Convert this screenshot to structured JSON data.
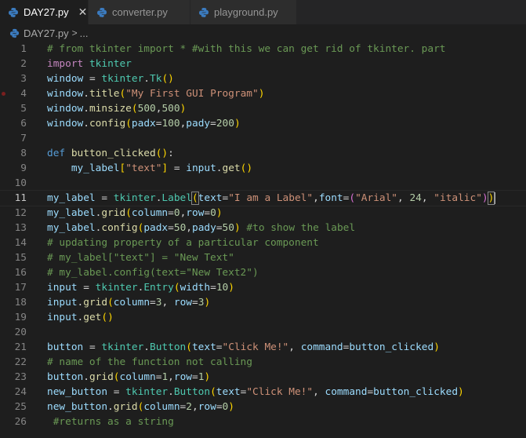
{
  "tabs": [
    {
      "label": "DAY27.py",
      "close": "✕"
    },
    {
      "label": "converter.py",
      "close": "✕"
    },
    {
      "label": "playground.py",
      "close": "✕"
    }
  ],
  "breadcrumb": {
    "file": "DAY27.py",
    "separator": ">",
    "more": "..."
  },
  "colors": {
    "background": "#1e1e1e",
    "comment": "#6a9955",
    "keyword": "#c586c0",
    "variable": "#9cdcfe",
    "function": "#dcdcaa",
    "class": "#4ec9b0",
    "string": "#ce9178",
    "number": "#b5cea8",
    "python_icon": "#3b7bbf"
  },
  "editor": {
    "current_line": 11,
    "lines": [
      {
        "n": "1",
        "tokens": [
          [
            "com",
            "# from tkinter import * #with this we can get rid of tkinter. part"
          ]
        ]
      },
      {
        "n": "2",
        "tokens": [
          [
            "kw",
            "import"
          ],
          [
            "op",
            " "
          ],
          [
            "cls",
            "tkinter"
          ]
        ]
      },
      {
        "n": "3",
        "tokens": [
          [
            "var",
            "window"
          ],
          [
            "op",
            " = "
          ],
          [
            "cls",
            "tkinter"
          ],
          [
            "op",
            "."
          ],
          [
            "cls",
            "Tk"
          ],
          [
            "br",
            "()"
          ]
        ]
      },
      {
        "n": "4",
        "tokens": [
          [
            "var",
            "window"
          ],
          [
            "op",
            "."
          ],
          [
            "fn",
            "title"
          ],
          [
            "br",
            "("
          ],
          [
            "str",
            "\"My First GUI Program\""
          ],
          [
            "br",
            ")"
          ]
        ]
      },
      {
        "n": "5",
        "tokens": [
          [
            "var",
            "window"
          ],
          [
            "op",
            "."
          ],
          [
            "fn",
            "minsize"
          ],
          [
            "br",
            "("
          ],
          [
            "num",
            "500"
          ],
          [
            "op",
            ","
          ],
          [
            "num",
            "500"
          ],
          [
            "br",
            ")"
          ]
        ]
      },
      {
        "n": "6",
        "tokens": [
          [
            "var",
            "window"
          ],
          [
            "op",
            "."
          ],
          [
            "fn",
            "config"
          ],
          [
            "br",
            "("
          ],
          [
            "var",
            "padx"
          ],
          [
            "op",
            "="
          ],
          [
            "num",
            "100"
          ],
          [
            "op",
            ","
          ],
          [
            "var",
            "pady"
          ],
          [
            "op",
            "="
          ],
          [
            "num",
            "200"
          ],
          [
            "br",
            ")"
          ]
        ]
      },
      {
        "n": "7",
        "tokens": []
      },
      {
        "n": "8",
        "tokens": [
          [
            "def",
            "def"
          ],
          [
            "op",
            " "
          ],
          [
            "fn",
            "button_clicked"
          ],
          [
            "br",
            "()"
          ],
          [
            "op",
            ":"
          ]
        ]
      },
      {
        "n": "9",
        "tokens": [
          [
            "op",
            "    "
          ],
          [
            "var",
            "my_label"
          ],
          [
            "br",
            "["
          ],
          [
            "str",
            "\"text\""
          ],
          [
            "br",
            "]"
          ],
          [
            "op",
            " = "
          ],
          [
            "var",
            "input"
          ],
          [
            "op",
            "."
          ],
          [
            "fn",
            "get"
          ],
          [
            "br",
            "()"
          ]
        ]
      },
      {
        "n": "10",
        "tokens": []
      },
      {
        "n": "11",
        "tokens": [
          [
            "var",
            "my_label"
          ],
          [
            "op",
            " = "
          ],
          [
            "cls",
            "tkinter"
          ],
          [
            "op",
            "."
          ],
          [
            "cls",
            "Label"
          ],
          [
            "brm",
            "("
          ],
          [
            "var",
            "text"
          ],
          [
            "op",
            "="
          ],
          [
            "str",
            "\"I am a Label\""
          ],
          [
            "op",
            ","
          ],
          [
            "var",
            "font"
          ],
          [
            "op",
            "="
          ],
          [
            "br2",
            "("
          ],
          [
            "str",
            "\"Arial\""
          ],
          [
            "op",
            ", "
          ],
          [
            "num",
            "24"
          ],
          [
            "op",
            ", "
          ],
          [
            "str",
            "\"italic\""
          ],
          [
            "br2",
            ")"
          ],
          [
            "brm",
            ")"
          ]
        ]
      },
      {
        "n": "12",
        "tokens": [
          [
            "var",
            "my_label"
          ],
          [
            "op",
            "."
          ],
          [
            "fn",
            "grid"
          ],
          [
            "br",
            "("
          ],
          [
            "var",
            "column"
          ],
          [
            "op",
            "="
          ],
          [
            "num",
            "0"
          ],
          [
            "op",
            ","
          ],
          [
            "var",
            "row"
          ],
          [
            "op",
            "="
          ],
          [
            "num",
            "0"
          ],
          [
            "br",
            ")"
          ]
        ]
      },
      {
        "n": "13",
        "tokens": [
          [
            "var",
            "my_label"
          ],
          [
            "op",
            "."
          ],
          [
            "fn",
            "config"
          ],
          [
            "br",
            "("
          ],
          [
            "var",
            "padx"
          ],
          [
            "op",
            "="
          ],
          [
            "num",
            "50"
          ],
          [
            "op",
            ","
          ],
          [
            "var",
            "pady"
          ],
          [
            "op",
            "="
          ],
          [
            "num",
            "50"
          ],
          [
            "br",
            ")"
          ],
          [
            "op",
            " "
          ],
          [
            "com",
            "#to show the label"
          ]
        ]
      },
      {
        "n": "14",
        "tokens": [
          [
            "com",
            "# updating property of a particular component"
          ]
        ]
      },
      {
        "n": "15",
        "tokens": [
          [
            "com",
            "# my_label[\"text\"] = \"New Text\""
          ]
        ]
      },
      {
        "n": "16",
        "tokens": [
          [
            "com",
            "# my_label.config(text=\"New Text2\")"
          ]
        ]
      },
      {
        "n": "17",
        "tokens": [
          [
            "var",
            "input"
          ],
          [
            "op",
            " = "
          ],
          [
            "cls",
            "tkinter"
          ],
          [
            "op",
            "."
          ],
          [
            "cls",
            "Entry"
          ],
          [
            "br",
            "("
          ],
          [
            "var",
            "width"
          ],
          [
            "op",
            "="
          ],
          [
            "num",
            "10"
          ],
          [
            "br",
            ")"
          ]
        ]
      },
      {
        "n": "18",
        "tokens": [
          [
            "var",
            "input"
          ],
          [
            "op",
            "."
          ],
          [
            "fn",
            "grid"
          ],
          [
            "br",
            "("
          ],
          [
            "var",
            "column"
          ],
          [
            "op",
            "="
          ],
          [
            "num",
            "3"
          ],
          [
            "op",
            ", "
          ],
          [
            "var",
            "row"
          ],
          [
            "op",
            "="
          ],
          [
            "num",
            "3"
          ],
          [
            "br",
            ")"
          ]
        ]
      },
      {
        "n": "19",
        "tokens": [
          [
            "var",
            "input"
          ],
          [
            "op",
            "."
          ],
          [
            "fn",
            "get"
          ],
          [
            "br",
            "()"
          ]
        ]
      },
      {
        "n": "20",
        "tokens": []
      },
      {
        "n": "21",
        "tokens": [
          [
            "var",
            "button"
          ],
          [
            "op",
            " = "
          ],
          [
            "cls",
            "tkinter"
          ],
          [
            "op",
            "."
          ],
          [
            "cls",
            "Button"
          ],
          [
            "br",
            "("
          ],
          [
            "var",
            "text"
          ],
          [
            "op",
            "="
          ],
          [
            "str",
            "\"Click Me!\""
          ],
          [
            "op",
            ", "
          ],
          [
            "var",
            "command"
          ],
          [
            "op",
            "="
          ],
          [
            "var",
            "button_clicked"
          ],
          [
            "br",
            ")"
          ]
        ]
      },
      {
        "n": "22",
        "tokens": [
          [
            "com",
            "# name of the function not calling"
          ]
        ]
      },
      {
        "n": "23",
        "tokens": [
          [
            "var",
            "button"
          ],
          [
            "op",
            "."
          ],
          [
            "fn",
            "grid"
          ],
          [
            "br",
            "("
          ],
          [
            "var",
            "column"
          ],
          [
            "op",
            "="
          ],
          [
            "num",
            "1"
          ],
          [
            "op",
            ","
          ],
          [
            "var",
            "row"
          ],
          [
            "op",
            "="
          ],
          [
            "num",
            "1"
          ],
          [
            "br",
            ")"
          ]
        ]
      },
      {
        "n": "24",
        "tokens": [
          [
            "var",
            "new_button"
          ],
          [
            "op",
            " = "
          ],
          [
            "cls",
            "tkinter"
          ],
          [
            "op",
            "."
          ],
          [
            "cls",
            "Button"
          ],
          [
            "br",
            "("
          ],
          [
            "var",
            "text"
          ],
          [
            "op",
            "="
          ],
          [
            "str",
            "\"Click Me!\""
          ],
          [
            "op",
            ", "
          ],
          [
            "var",
            "command"
          ],
          [
            "op",
            "="
          ],
          [
            "var",
            "button_clicked"
          ],
          [
            "br",
            ")"
          ]
        ]
      },
      {
        "n": "25",
        "tokens": [
          [
            "var",
            "new_button"
          ],
          [
            "op",
            "."
          ],
          [
            "fn",
            "grid"
          ],
          [
            "br",
            "("
          ],
          [
            "var",
            "column"
          ],
          [
            "op",
            "="
          ],
          [
            "num",
            "2"
          ],
          [
            "op",
            ","
          ],
          [
            "var",
            "row"
          ],
          [
            "op",
            "="
          ],
          [
            "num",
            "0"
          ],
          [
            "br",
            ")"
          ]
        ]
      },
      {
        "n": "26",
        "tokens": [
          [
            "op",
            " "
          ],
          [
            "com",
            "#returns as a string"
          ]
        ]
      }
    ]
  }
}
